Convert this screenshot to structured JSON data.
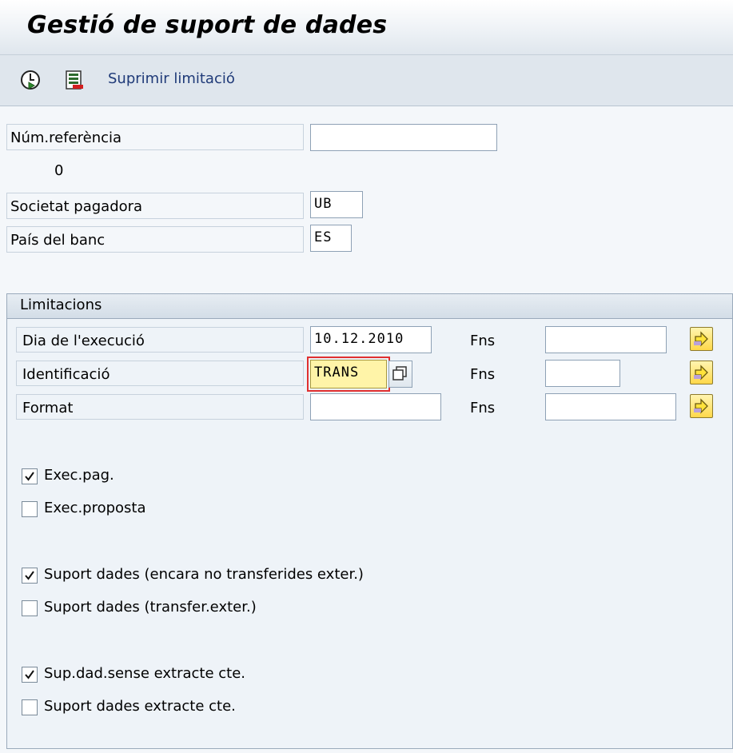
{
  "window": {
    "title": "Gestió de suport de dades"
  },
  "toolbar": {
    "execute_icon": "clock-execute-icon",
    "variant_icon": "save-variant-icon",
    "delete_limitation_label": "Suprimir limitació"
  },
  "header": {
    "ref_label": "Núm.referència",
    "ref_value": "",
    "ref_count": "0",
    "company_label": "Societat pagadora",
    "company_value": "UB",
    "country_label": "País del banc",
    "country_value": "ES"
  },
  "limitations": {
    "title": "Limitacions",
    "rows": [
      {
        "label": "Dia de l'execució",
        "value": "10.12.2010",
        "to_label": "Fns",
        "to_value": ""
      },
      {
        "label": "Identificació",
        "value": "TRANS",
        "to_label": "Fns",
        "to_value": ""
      },
      {
        "label": "Format",
        "value": "",
        "to_label": "Fns",
        "to_value": ""
      }
    ],
    "checkboxes": [
      {
        "label": "Exec.pag.",
        "checked": true
      },
      {
        "label": "Exec.proposta",
        "checked": false
      },
      {
        "label": "Suport dades (encara no transferides exter.)",
        "checked": true
      },
      {
        "label": "Suport dades (transfer.exter.)",
        "checked": false
      },
      {
        "label": "Sup.dad.sense extracte cte.",
        "checked": true
      },
      {
        "label": "Suport dades extracte cte.",
        "checked": false
      }
    ]
  },
  "colors": {
    "input_highlight": "#fff4a8",
    "focus_border": "#e03030",
    "link": "#1f3a78"
  }
}
